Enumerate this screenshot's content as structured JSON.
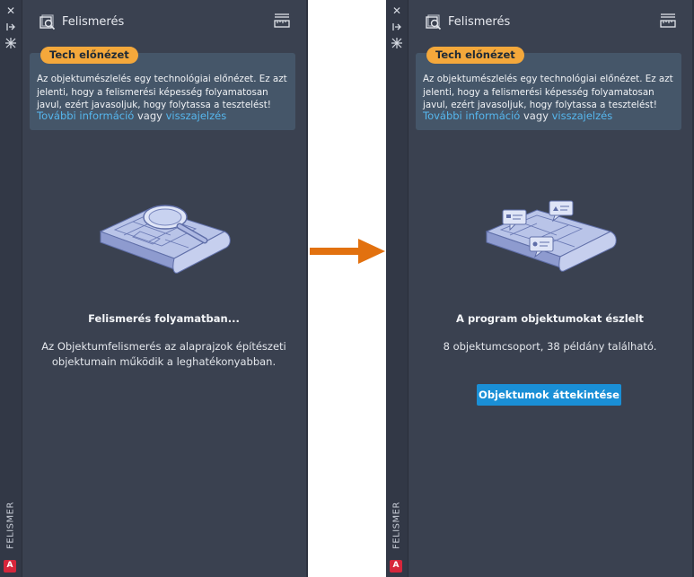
{
  "panel_before": {
    "title": "Felismerés",
    "badge": "Tech előnézet",
    "notice_text": "Az objektumészlelés egy technológiai előnézet. Ez azt jelenti, hogy a felismerési képesség folyamatosan javul, ezért javasoljuk, hogy folytassa a tesztelést!",
    "more_info_link": "További információ",
    "or_text": "vagy",
    "feedback_link": "visszajelzés",
    "status_title": "Felismerés folyamatban...",
    "status_line1": "Az Objektumfelismerés az alaprajzok építészeti",
    "status_line2": "objektumain működik a leghatékonyabban.",
    "vertical_label": "FELISMER",
    "app_badge": "A"
  },
  "panel_after": {
    "title": "Felismerés",
    "badge": "Tech előnézet",
    "notice_text": "Az objektumészlelés egy technológiai előnézet. Ez azt jelenti, hogy a felismerési képesség folyamatosan javul, ezért javasoljuk, hogy folytassa a tesztelést!",
    "more_info_link": "További információ",
    "or_text": "vagy",
    "feedback_link": "visszajelzés",
    "status_title": "A program objektumokat észlelt",
    "status_desc": "8 objektumcsoport, 38 példány található.",
    "button_label": "Objektumok áttekintése",
    "vertical_label": "FELISMER",
    "app_badge": "A"
  },
  "colors": {
    "panel_bg": "#3a4150",
    "notice_bg": "#455669",
    "badge_bg": "#f4a83b",
    "link": "#56b7ee",
    "button": "#1a8fd6",
    "arrow": "#e2710f"
  }
}
